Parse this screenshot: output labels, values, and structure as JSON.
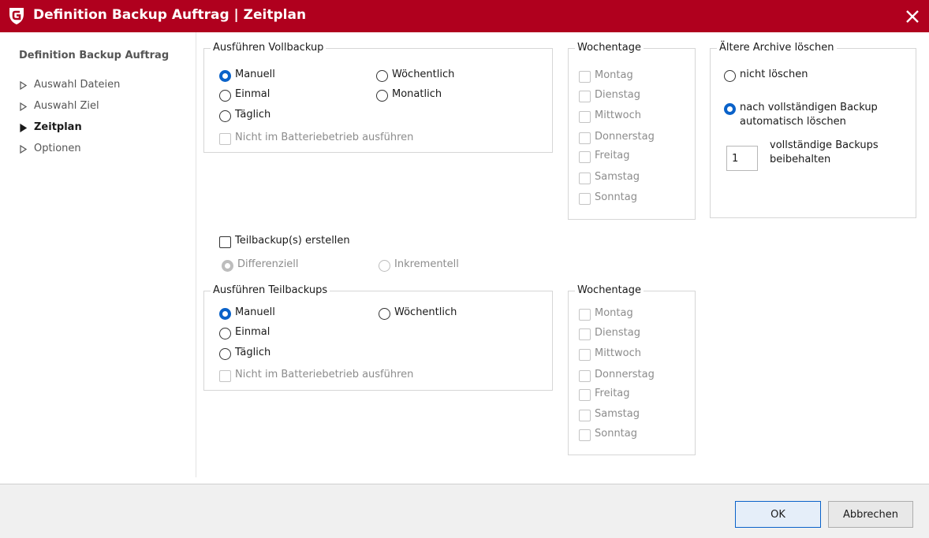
{
  "window": {
    "title": "Definition Backup Auftrag | Zeitplan"
  },
  "sidebar": {
    "heading": "Definition Backup Auftrag",
    "items": [
      {
        "label": "Auswahl Dateien",
        "active": false
      },
      {
        "label": "Auswahl Ziel",
        "active": false
      },
      {
        "label": "Zeitplan",
        "active": true
      },
      {
        "label": "Optionen",
        "active": false
      }
    ]
  },
  "full_backup": {
    "legend": "Ausführen Vollbackup",
    "options": {
      "manuell": "Manuell",
      "woechentlich": "Wöchentlich",
      "einmal": "Einmal",
      "monatlich": "Monatlich",
      "taeglich": "Täglich"
    },
    "selected": "Manuell",
    "battery_label": "Nicht im Batteriebetrieb ausführen",
    "battery_checked": false
  },
  "full_weekdays": {
    "legend": "Wochentage",
    "days": [
      "Montag",
      "Dienstag",
      "Mittwoch",
      "Donnerstag",
      "Freitag",
      "Samstag",
      "Sonntag"
    ]
  },
  "archive": {
    "legend": "Ältere Archive löschen",
    "option_none": "nicht löschen",
    "option_auto_line1": "nach vollständigen Backup",
    "option_auto_line2": "automatisch löschen",
    "selected": "auto",
    "keep_value": "1",
    "keep_label_line1": "vollständige Backups",
    "keep_label_line2": "beibehalten"
  },
  "partial": {
    "create_label": "Teilbackup(s) erstellen",
    "create_checked": false,
    "type_differential": "Differenziell",
    "type_incremental": "Inkrementell",
    "type_selected": "Differenziell"
  },
  "partial_backup": {
    "legend": "Ausführen Teilbackups",
    "options": {
      "manuell": "Manuell",
      "woechentlich": "Wöchentlich",
      "einmal": "Einmal",
      "taeglich": "Täglich"
    },
    "selected": "Manuell",
    "battery_label": "Nicht im Batteriebetrieb ausführen",
    "battery_checked": false
  },
  "partial_weekdays": {
    "legend": "Wochentage",
    "days": [
      "Montag",
      "Dienstag",
      "Mittwoch",
      "Donnerstag",
      "Freitag",
      "Samstag",
      "Sonntag"
    ]
  },
  "footer": {
    "ok_label": "OK",
    "cancel_label": "Abbrechen"
  },
  "colors": {
    "titlebar": "#b0001e",
    "accent": "#0a62c9"
  }
}
